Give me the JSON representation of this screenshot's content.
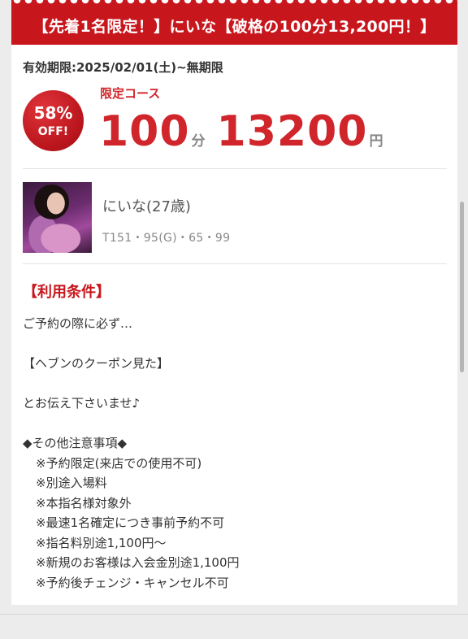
{
  "banner": {
    "text": "【先着1名限定！】にいな【破格の100分13,200円！】"
  },
  "coupon": {
    "validity": "有効期限:2025/02/01(土)~無期限",
    "badge_percent": "58%",
    "badge_off": "OFF!",
    "course_label": "限定コース",
    "minutes": "100",
    "minutes_unit": "分",
    "price": "13200",
    "price_unit": "円"
  },
  "girl": {
    "name": "にいな(27歳)",
    "stats": "T151・95(G)・65・99"
  },
  "terms": {
    "heading": "【利用条件】",
    "lines": [
      "ご予約の際に必ず…",
      "",
      "【ヘブンのクーポン見た】",
      "",
      "とお伝え下さいませ♪",
      "",
      "◆その他注意事項◆"
    ],
    "notes": [
      "※予約限定(来店での使用不可)",
      "※別途入場料",
      "※本指名様対象外",
      "※最速1名確定につき事前予約不可",
      "※指名料別途1,100円〜",
      "※新規のお客様は入会金別途1,100円",
      "※予約後チェンジ・キャンセル不可"
    ]
  },
  "colors": {
    "accent": "#c8161d",
    "price": "#d0252b"
  }
}
